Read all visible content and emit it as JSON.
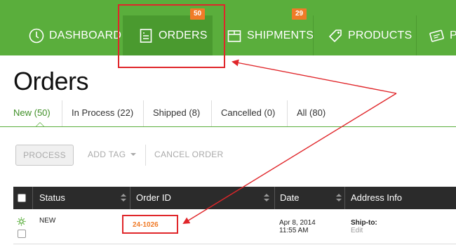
{
  "nav": {
    "items": [
      {
        "label": "DASHBOARD",
        "icon": "dashboard-icon"
      },
      {
        "label": "ORDERS",
        "icon": "orders-icon",
        "active": true,
        "badge": "50"
      },
      {
        "label": "SHIPMENTS",
        "icon": "shipments-icon",
        "badge": "29"
      },
      {
        "label": "PRODUCTS",
        "icon": "tag-icon"
      },
      {
        "label": "PO",
        "icon": "purchase-order-icon"
      }
    ],
    "colors": {
      "bar": "#5aae3c",
      "active": "#4a9a2f",
      "badge": "#f07b28"
    }
  },
  "page": {
    "title": "Orders"
  },
  "tabs": [
    {
      "label": "New (50)",
      "active": true
    },
    {
      "label": "In Process (22)"
    },
    {
      "label": "Shipped (8)"
    },
    {
      "label": "Cancelled (0)"
    },
    {
      "label": "All (80)"
    }
  ],
  "toolbar": {
    "process": "PROCESS",
    "add_tag": "ADD TAG",
    "cancel_order": "CANCEL ORDER"
  },
  "table": {
    "columns": [
      "Status",
      "Order ID",
      "Date",
      "Address Info"
    ],
    "rows": [
      {
        "status": "NEW",
        "order_id": "24-1026",
        "date": "Apr 8, 2014",
        "time": "11:55 AM",
        "ship_to": "Ship-to:",
        "edit": "Edit"
      }
    ]
  },
  "annotation": {
    "color": "#e0262a"
  }
}
